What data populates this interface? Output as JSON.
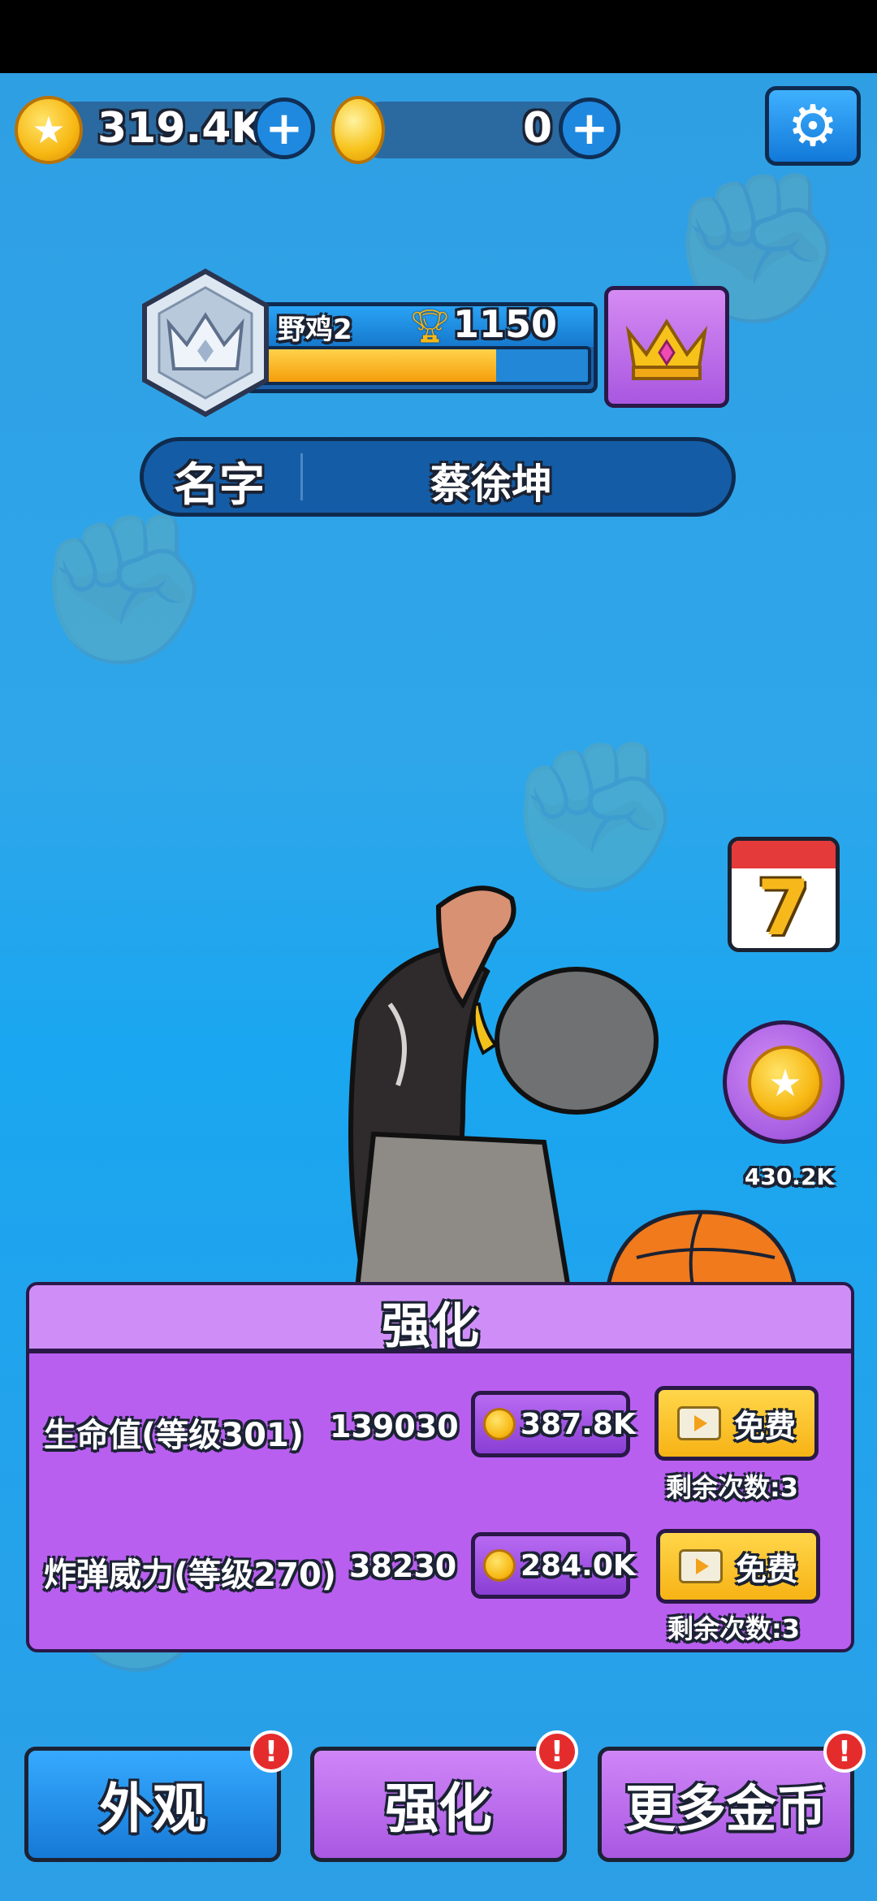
{
  "currency": {
    "gold_amount": "319.4K",
    "gem_amount": "0"
  },
  "rank": {
    "tier_name": "野鸡2",
    "trophies": "1150",
    "progress": 0.72
  },
  "name_bar": {
    "label": "名字",
    "value": "蔡徐坤"
  },
  "side": {
    "calendar_day": "7",
    "coin_reward": "430.2K"
  },
  "upgrade_panel": {
    "title": "强化",
    "rows": [
      {
        "label": "生命值(等级301)",
        "value": "139030",
        "cost": "387.8K",
        "free_label": "免费",
        "remaining": "剩余次数:3"
      },
      {
        "label": "炸弹威力(等级270)",
        "value": "38230",
        "cost": "284.0K",
        "free_label": "免费",
        "remaining": "剩余次数:3"
      }
    ]
  },
  "bottom_nav": {
    "appearance": "外观",
    "upgrade": "强化",
    "more_coins": "更多金币",
    "badge": "!"
  },
  "colors": {
    "background": "#2fa6ea",
    "panel_purple": "#b95ff0",
    "free_button_yellow": "#f7b315",
    "nav_blue": "#1679d6"
  }
}
